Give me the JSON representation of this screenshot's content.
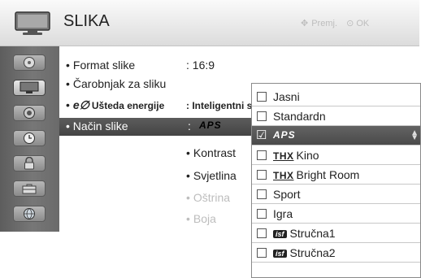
{
  "header": {
    "title": "SLIKA",
    "hint_move": "Premj.",
    "hint_ok": "OK"
  },
  "sidebar": {
    "items": [
      {
        "icon": "disc-icon"
      },
      {
        "icon": "tv-icon",
        "active": true
      },
      {
        "icon": "speaker-icon"
      },
      {
        "icon": "clock-icon"
      },
      {
        "icon": "lock-icon"
      },
      {
        "icon": "toolbox-icon"
      },
      {
        "icon": "globe-icon"
      }
    ]
  },
  "menu": {
    "items": [
      {
        "label": "Format slike",
        "value": ": 16:9"
      },
      {
        "label": "Čarobnjak za sliku",
        "value": ""
      },
      {
        "label": "Ušteda energije",
        "value": ": Inteligentni se"
      },
      {
        "label": "Način slike",
        "value": ":"
      },
      {
        "label": "Kontrast"
      },
      {
        "label": "Svjetlina"
      },
      {
        "label": "Oštrina"
      },
      {
        "label": "Boja"
      }
    ],
    "aps_logo": "APS",
    "bullet": "•"
  },
  "dropdown": {
    "options": [
      {
        "label": "Jasni",
        "checked": false
      },
      {
        "label": "Standardn",
        "checked": false
      },
      {
        "label": "APS",
        "checked": true
      },
      {
        "label": "Kino",
        "prefix": "THX",
        "checked": false
      },
      {
        "label": "Bright Room",
        "prefix": "THX",
        "checked": false
      },
      {
        "label": "Sport",
        "checked": false
      },
      {
        "label": "Igra",
        "checked": false
      },
      {
        "label": "Stručna1",
        "prefix": "isf",
        "checked": false
      },
      {
        "label": "Stručna2",
        "prefix": "isf",
        "checked": false
      }
    ]
  },
  "colors": {
    "selection": "#4f4f4f",
    "sidebar": "#6a6a6a",
    "dim_text": "#bdbdbd"
  }
}
